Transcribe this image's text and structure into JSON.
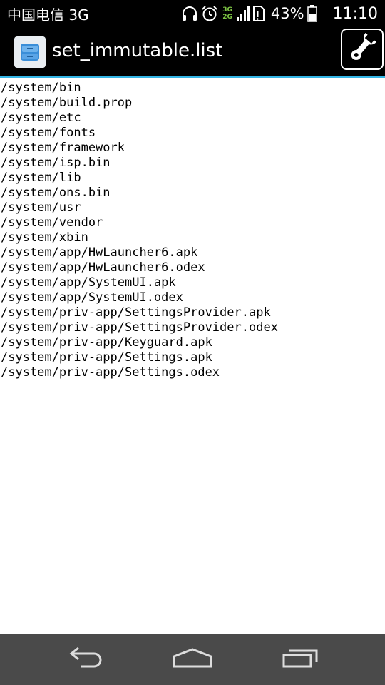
{
  "status_bar": {
    "carrier": "中国电信 3G",
    "net_top": "3G",
    "net_bottom": "2G",
    "battery_percent": "43%",
    "time": "11:10",
    "icons": [
      "headphones-icon",
      "alarm-icon",
      "signal-icon",
      "sim-icon",
      "battery-icon"
    ]
  },
  "action_bar": {
    "title": "set_immutable.list",
    "app_icon": "file-manager-icon",
    "action_icon": "wrench-icon"
  },
  "content": {
    "lines": [
      "/system/bin",
      "/system/build.prop",
      "/system/etc",
      "/system/fonts",
      "/system/framework",
      "/system/isp.bin",
      "/system/lib",
      "/system/ons.bin",
      "/system/usr",
      "/system/vendor",
      "/system/xbin",
      "/system/app/HwLauncher6.apk",
      "/system/app/HwLauncher6.odex",
      "/system/app/SystemUI.apk",
      "/system/app/SystemUI.odex",
      "/system/priv-app/SettingsProvider.apk",
      "/system/priv-app/SettingsProvider.odex",
      "/system/priv-app/Keyguard.apk",
      "/system/priv-app/Settings.apk",
      "/system/priv-app/Settings.odex"
    ]
  },
  "nav_bar": {
    "buttons": [
      "back-icon",
      "home-icon",
      "recents-icon"
    ]
  },
  "colors": {
    "accent": "#33b5e5",
    "nav_bg": "#4a4a4a",
    "bar_bg": "#000000"
  }
}
